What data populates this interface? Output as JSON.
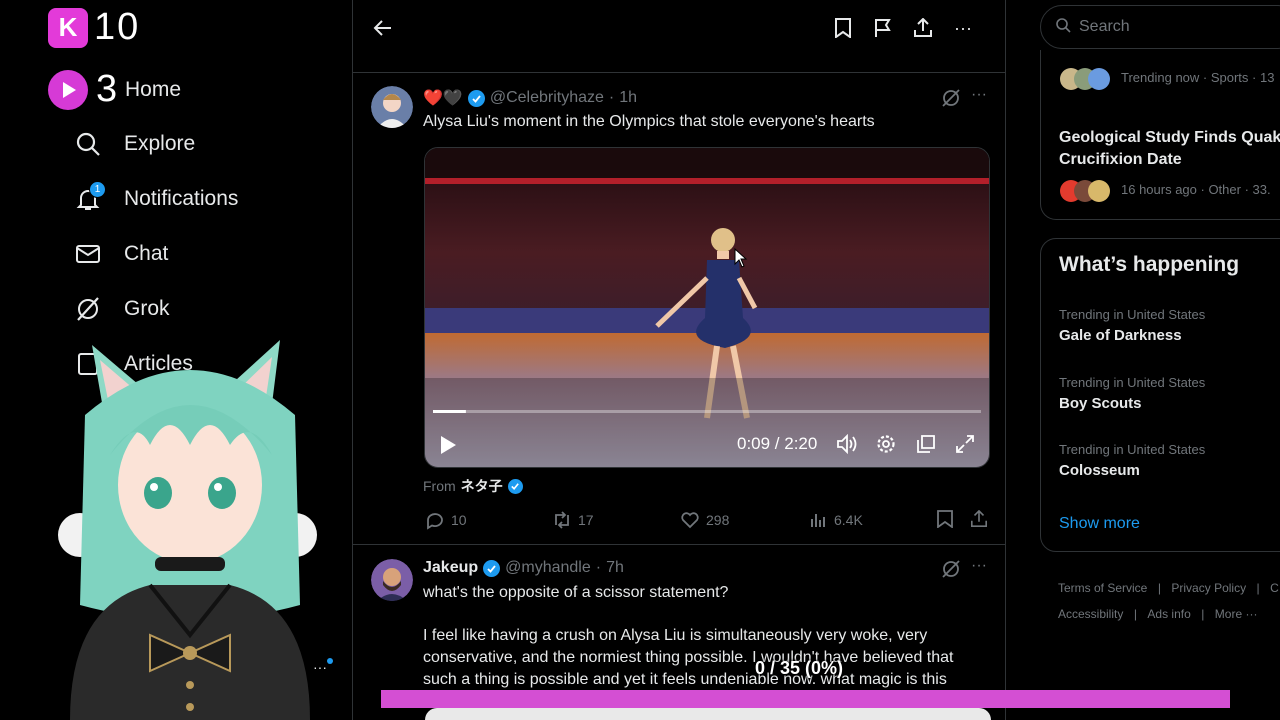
{
  "overlay": {
    "k_counter": "10",
    "k_icon_letter": "K",
    "play_counter": "3",
    "progress_text": "0 / 35 (0%)",
    "progress_fraction": 0,
    "accent": "#d44fd3"
  },
  "nav": {
    "items": [
      {
        "label": "Home",
        "icon": "home-icon"
      },
      {
        "label": "Explore",
        "icon": "search-icon"
      },
      {
        "label": "Notifications",
        "icon": "bell-icon",
        "badge": "1"
      },
      {
        "label": "Chat",
        "icon": "mail-icon"
      },
      {
        "label": "Grok",
        "icon": "grok-icon"
      },
      {
        "label": "Articles",
        "icon": "articles-icon"
      }
    ]
  },
  "post1": {
    "emoji": "❤️🖤",
    "handle": "@Celebrityhaze",
    "time": "1h",
    "text": "Alysa Liu's moment in the Olympics that stole everyone's hearts",
    "video_time": "0:09 / 2:20",
    "video_progress": 0.06,
    "from_label": "From",
    "from_name": "ネタ子",
    "replies": "10",
    "reposts": "17",
    "likes": "298",
    "views": "6.4K"
  },
  "post2": {
    "name": "Jakeup",
    "handle": "@myhandle",
    "time": "7h",
    "line1": "what's the opposite of a scissor statement?",
    "line2": "I feel like having a crush on Alysa Liu is simultaneously very woke, very",
    "line3": "conservative, and the normiest thing possible. I wouldn't have believed that",
    "line4": "such a thing is possible and yet it feels undeniable now. what magic is this"
  },
  "right": {
    "search_placeholder": "Search",
    "trend_top_meta": "Trending now · Sports · 13",
    "story_title_1": "Geological Study Finds Quak",
    "story_title_2": "Crucifixion Date",
    "story_meta": "16 hours ago · Other · 33.",
    "happening_title": "What’s happening",
    "trends": [
      {
        "category": "Trending in United States",
        "name": "Gale of Darkness"
      },
      {
        "category": "Trending in United States",
        "name": "Boy Scouts"
      },
      {
        "category": "Trending in United States",
        "name": "Colosseum"
      }
    ],
    "show_more": "Show more",
    "footer": [
      "Terms of Service",
      "Privacy Policy",
      "C",
      "Accessibility",
      "Ads info",
      "More ···"
    ]
  },
  "colors": {
    "accent_blue": "#1d9bf0",
    "border": "#2f3336",
    "muted": "#71767b",
    "heart": "#f91880"
  }
}
